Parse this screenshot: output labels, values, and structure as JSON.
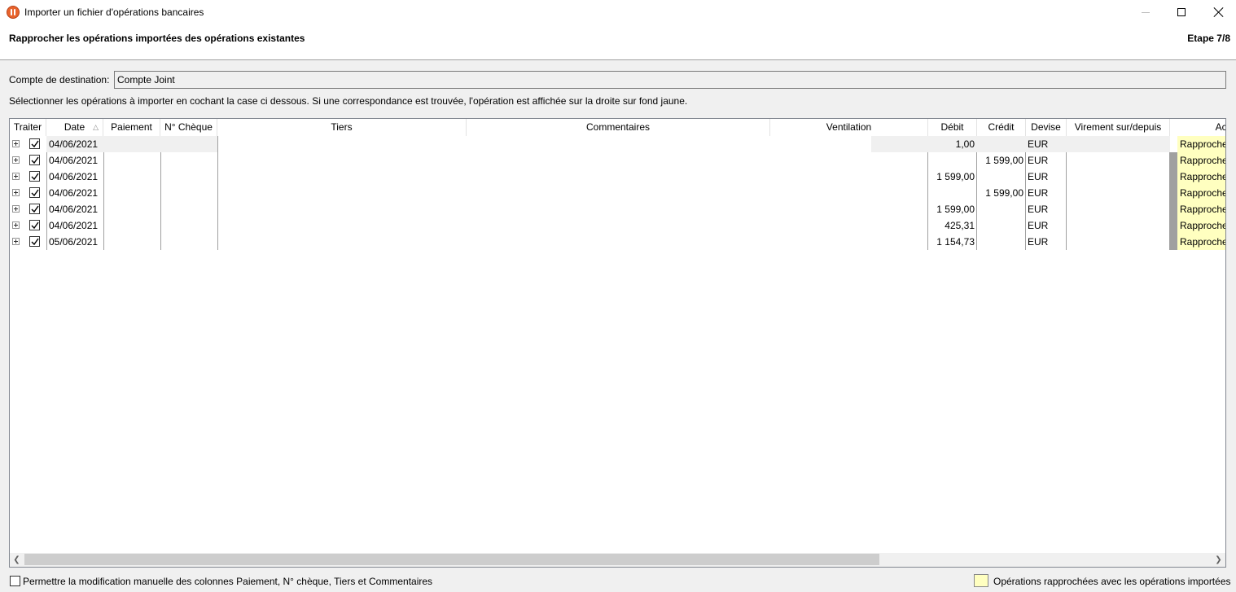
{
  "window": {
    "title": "Importer un fichier d'opérations bancaires"
  },
  "header": {
    "step_title": "Rapprocher les opérations importées des opérations existantes",
    "step_count": "Etape 7/8"
  },
  "destination": {
    "label": "Compte de destination:",
    "value": "Compte Joint"
  },
  "instructions": "Sélectionner les opérations à importer en cochant la case ci dessous. Si une correspondance est trouvée, l'opération est affichée sur la droite sur fond jaune.",
  "grid": {
    "columns": {
      "traiter": "Traiter",
      "date": "Date",
      "paiement": "Paiement",
      "cheque": "N° Chèque",
      "tiers": "Tiers",
      "commentaires": "Commentaires",
      "ventilation": "Ventilation",
      "debit": "Débit",
      "credit": "Crédit",
      "devise": "Devise",
      "virement": "Virement sur/depuis",
      "action": "Action"
    },
    "sort_icon": "sort-ascending-icon",
    "rows": [
      {
        "date": "04/06/2021",
        "debit": "1,00",
        "credit": "",
        "devise": "EUR",
        "action": "Rapproche",
        "checked": true
      },
      {
        "date": "04/06/2021",
        "debit": "",
        "credit": "1 599,00",
        "devise": "EUR",
        "action": "Rapproche",
        "checked": true
      },
      {
        "date": "04/06/2021",
        "debit": "1 599,00",
        "credit": "",
        "devise": "EUR",
        "action": "Rapproche",
        "checked": true
      },
      {
        "date": "04/06/2021",
        "debit": "",
        "credit": "1 599,00",
        "devise": "EUR",
        "action": "Rapproche",
        "checked": true
      },
      {
        "date": "04/06/2021",
        "debit": "1 599,00",
        "credit": "",
        "devise": "EUR",
        "action": "Rapproche",
        "checked": true
      },
      {
        "date": "04/06/2021",
        "debit": "425,31",
        "credit": "",
        "devise": "EUR",
        "action": "Rapproche",
        "checked": true
      },
      {
        "date": "05/06/2021",
        "debit": "1 154,73",
        "credit": "",
        "devise": "EUR",
        "action": "Rapproche",
        "checked": true
      }
    ]
  },
  "footer": {
    "manual_edit_label": "Permettre la modification manuelle des colonnes Paiement, N° chèque, Tiers et Commentaires",
    "manual_edit_checked": false,
    "legend_label": "Opérations rapprochées avec les opérations importées",
    "legend_color": "#ffffc0"
  }
}
